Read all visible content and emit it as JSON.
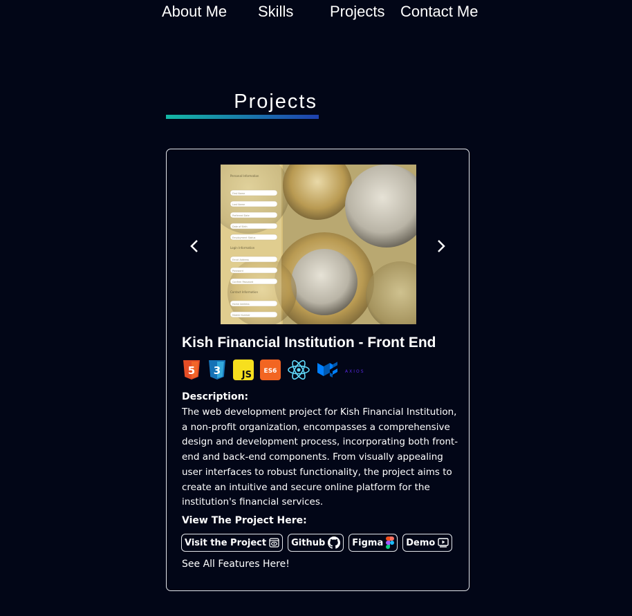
{
  "nav": {
    "items": [
      {
        "label": "About Me"
      },
      {
        "label": "Skills"
      },
      {
        "label": "Projects"
      },
      {
        "label": "Contact Me"
      }
    ]
  },
  "section": {
    "title": "Projects",
    "underline_colors": [
      "#14b8a6",
      "#1e40af"
    ]
  },
  "project": {
    "title": "Kish Financial Institution - Front End",
    "screenshot": {
      "form_labels": [
        "Personal Information",
        "Login Information",
        "Contact Information"
      ],
      "fields": [
        "First Name",
        "Last Name",
        "Preferred Date",
        "Date of Birth",
        "Employment Status",
        "Email Address",
        "Password",
        "Confirm Password",
        "Home Address",
        "Mobile Number"
      ]
    },
    "tech_icons": [
      {
        "name": "html5-icon",
        "text": "5"
      },
      {
        "name": "css3-icon",
        "text": "3"
      },
      {
        "name": "javascript-icon",
        "text": "JS"
      },
      {
        "name": "es6-icon",
        "text": "ES6"
      },
      {
        "name": "react-icon"
      },
      {
        "name": "material-ui-icon"
      },
      {
        "name": "axios-icon",
        "text": "AXIOS"
      }
    ],
    "description_label": "Description:",
    "description": "The web development project for Kish Financial Institution, a non-profit organization, encompasses a comprehensive design and development process, incorporating both front-end and back-end components. From visually appealing user interfaces to robust functionality, the project aims to create an intuitive and secure online platform for the institution's financial services.",
    "view_label": "View The Project Here:",
    "links": [
      {
        "label": "Visit the Project",
        "icon": "eye-icon"
      },
      {
        "label": "Github",
        "icon": "github-icon"
      },
      {
        "label": "Figma",
        "icon": "figma-icon"
      },
      {
        "label": "Demo",
        "icon": "play-icon"
      }
    ],
    "see_all": "See All Features Here!"
  },
  "colors": {
    "background": "#020617",
    "text": "#ffffff",
    "border": "#e5e7eb"
  }
}
